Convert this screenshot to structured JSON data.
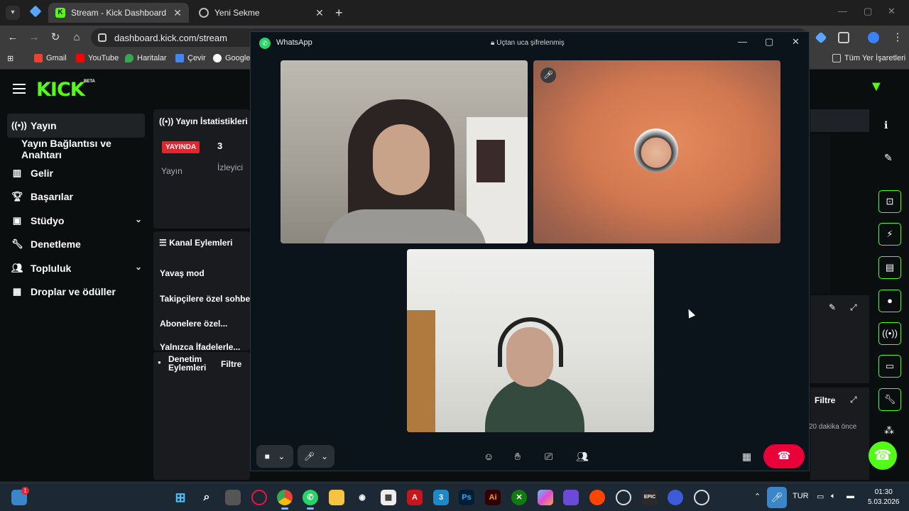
{
  "browser": {
    "tabs": [
      {
        "title": "Stream - Kick Dashboard",
        "active": true
      },
      {
        "title": "Yeni Sekme",
        "active": false
      }
    ],
    "url": "dashboard.kick.com/stream",
    "bookmarks": [
      "Gmail",
      "YouTube",
      "Haritalar",
      "Çevir",
      "Google"
    ],
    "all_bookmarks": "Tüm Yer İşaretleri"
  },
  "kick": {
    "logo": "KICK",
    "beta": "BETA",
    "sidebar": [
      {
        "label": "Yayın",
        "icon": "broadcast-icon"
      },
      {
        "label": "Yayın Bağlantısı ve Anahtarı",
        "icon": ""
      },
      {
        "label": "Gelir",
        "icon": "chart-icon"
      },
      {
        "label": "Başarılar",
        "icon": "trophy-icon"
      },
      {
        "label": "Stüdyo",
        "icon": "studio-icon"
      },
      {
        "label": "Denetleme",
        "icon": "wrench-icon"
      },
      {
        "label": "Topluluk",
        "icon": "community-icon"
      },
      {
        "label": "Droplar ve ödüller",
        "icon": "gift-icon"
      }
    ],
    "stats_panel": {
      "title": "Yayın İstatistikleri",
      "live_badge": "YAYINDA",
      "viewers": "3",
      "stream_label": "Yayın",
      "viewers_label": "İzleyici"
    },
    "channel_panel": {
      "title": "Kanal Eylemleri",
      "options": [
        "Yavaş mod",
        "Takipçilere özel sohbet",
        "Abonelere özel...",
        "Yalnızca İfadelerle..."
      ]
    },
    "moderation_panel": {
      "title_line1": "Denetim",
      "title_line2": "Eylemleri",
      "filter": "Filtre"
    },
    "right_panel": {
      "filter": "Filtre",
      "time_ago": "20 dakika önce"
    }
  },
  "whatsapp": {
    "app_name": "WhatsApp",
    "encryption": "Uçtan uca şifrelenmiş",
    "participant_count": 3
  },
  "taskbar": {
    "language": "TUR",
    "time": "01:30",
    "date": "5.03.2026",
    "notification_count": "1"
  }
}
